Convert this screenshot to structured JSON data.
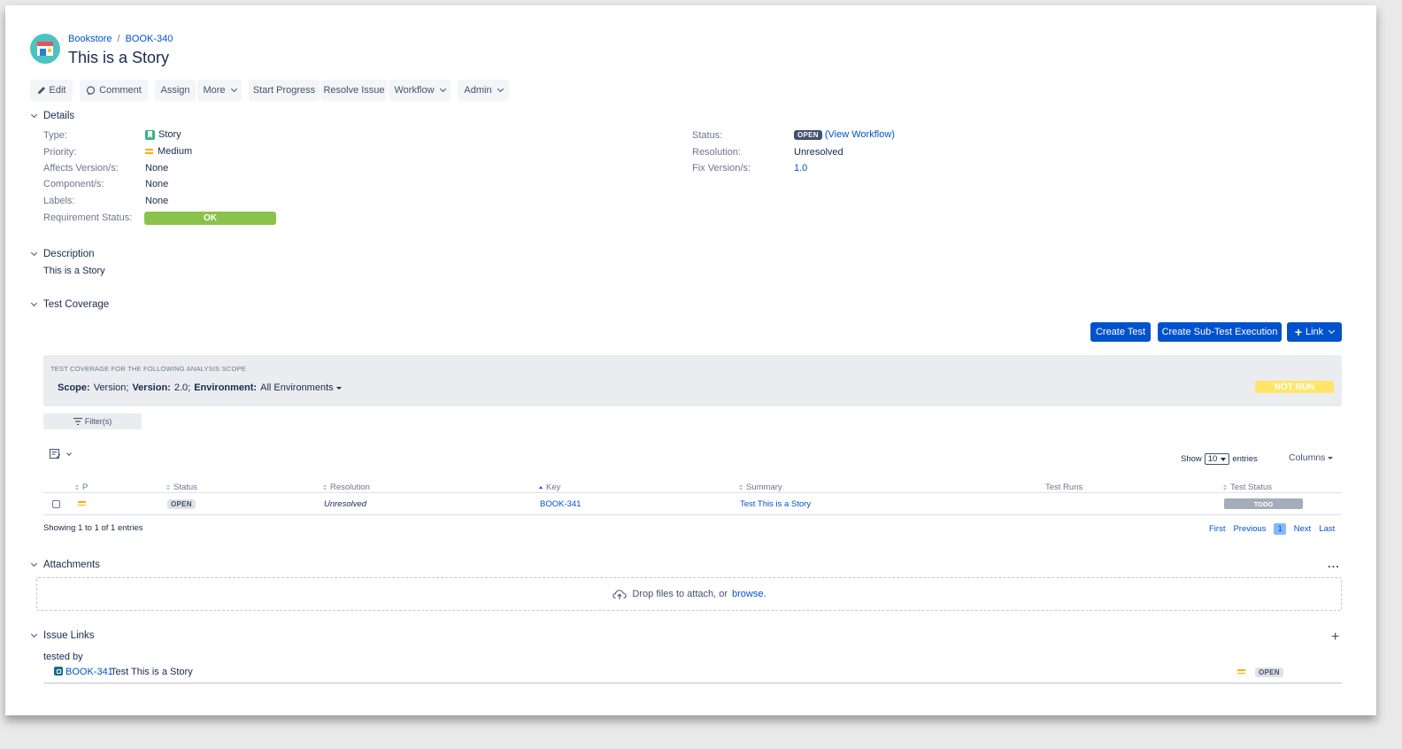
{
  "breadcrumb": {
    "project": "Bookstore",
    "separator": "/",
    "issue_key": "BOOK-340"
  },
  "issue_title": "This is a Story",
  "toolbar": {
    "edit": "Edit",
    "comment": "Comment",
    "assign": "Assign",
    "more": "More",
    "start_progress": "Start Progress",
    "resolve_issue": "Resolve Issue",
    "workflow": "Workflow",
    "admin": "Admin"
  },
  "details": {
    "title": "Details",
    "type_label": "Type:",
    "type_value": "Story",
    "priority_label": "Priority:",
    "priority_value": "Medium",
    "affects_label": "Affects Version/s:",
    "affects_value": "None",
    "component_label": "Component/s:",
    "component_value": "None",
    "labels_label": "Labels:",
    "labels_value": "None",
    "req_status_label": "Requirement Status:",
    "req_status_value": "OK",
    "status_label": "Status:",
    "status_value": "OPEN",
    "view_workflow": "(View Workflow)",
    "resolution_label": "Resolution:",
    "resolution_value": "Unresolved",
    "fix_label": "Fix Version/s:",
    "fix_value": "1.0"
  },
  "description": {
    "title": "Description",
    "text": "This is a Story"
  },
  "test_coverage": {
    "title": "Test Coverage",
    "create_test": "Create Test",
    "create_sub": "Create Sub-Test Execution",
    "link": "Link",
    "scope_heading": "TEST COVERAGE FOR THE FOLLOWING ANALYSIS SCOPE",
    "scope_label": "Scope:",
    "scope_value": "Version;",
    "version_label": "Version:",
    "version_value": "2.0;",
    "env_label": "Environment:",
    "env_value": "All Environments",
    "overall_status": "NOT RUN",
    "filters": "Filter(s)",
    "show": "Show",
    "entries_value": "10",
    "entries": "entries",
    "columns": "Columns",
    "headers": {
      "p": "P",
      "status": "Status",
      "resolution": "Resolution",
      "key": "Key",
      "summary": "Summary",
      "test_runs": "Test Runs",
      "test_status": "Test Status"
    },
    "rows": [
      {
        "status": "OPEN",
        "resolution": "Unresolved",
        "key": "BOOK-341",
        "summary": "Test This is a Story",
        "test_runs": "",
        "test_status": "TODO"
      }
    ],
    "showing": "Showing 1 to 1 of 1 entries",
    "pager": {
      "first": "First",
      "previous": "Previous",
      "page": "1",
      "next": "Next",
      "last": "Last"
    }
  },
  "attachments": {
    "title": "Attachments",
    "more": "...",
    "drop_text": "Drop files to attach, or",
    "browse": "browse."
  },
  "issue_links": {
    "title": "Issue Links",
    "add": "+",
    "relation": "tested by",
    "items": [
      {
        "key": "BOOK-341",
        "summary": "Test This is a Story",
        "status": "OPEN"
      }
    ]
  },
  "colors": {
    "accent": "#0052cc",
    "ok": "#8bc34a",
    "not_run": "#ffe66b",
    "todo": "#a5adba",
    "priority": "#ffab00"
  },
  "icons": [
    "pencil-icon",
    "comment-icon",
    "story-icon",
    "priority-medium-icon",
    "filter-icon",
    "table-edit-icon",
    "upload-cloud-icon",
    "test-issue-icon",
    "chevron-down-icon",
    "plus-icon"
  ]
}
